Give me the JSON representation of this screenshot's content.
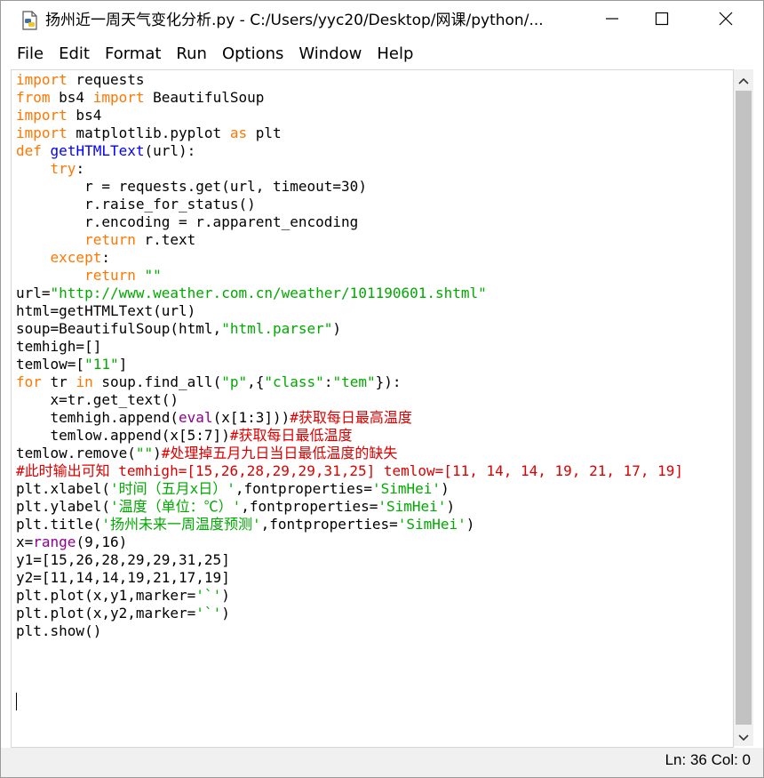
{
  "window": {
    "title": "扬州近一周天气变化分析.py - C:/Users/yyc20/Desktop/网课/python/...",
    "icons": {
      "app": "python-file-icon",
      "minimize": "minimize-icon",
      "maximize": "maximize-icon",
      "close": "close-icon"
    }
  },
  "menubar": {
    "items": [
      "File",
      "Edit",
      "Format",
      "Run",
      "Options",
      "Window",
      "Help"
    ]
  },
  "editor": {
    "lines": [
      [
        [
          "kw",
          "import"
        ],
        [
          "n",
          " requests"
        ]
      ],
      [
        [
          "kw",
          "from"
        ],
        [
          "n",
          " bs4 "
        ],
        [
          "kw",
          "import"
        ],
        [
          "n",
          " BeautifulSoup"
        ]
      ],
      [
        [
          "kw",
          "import"
        ],
        [
          "n",
          " bs4"
        ]
      ],
      [
        [
          "kw",
          "import"
        ],
        [
          "n",
          " matplotlib.pyplot "
        ],
        [
          "kw",
          "as"
        ],
        [
          "n",
          " plt"
        ]
      ],
      [
        [
          "kw",
          "def"
        ],
        [
          "n",
          " "
        ],
        [
          "df",
          "getHTMLText"
        ],
        [
          "n",
          "(url):"
        ]
      ],
      [
        [
          "n",
          "    "
        ],
        [
          "kw",
          "try"
        ],
        [
          "n",
          ":"
        ]
      ],
      [
        [
          "n",
          "        r = requests.get(url, timeout=30)"
        ]
      ],
      [
        [
          "n",
          "        r.raise_for_status()"
        ]
      ],
      [
        [
          "n",
          "        r.encoding = r.apparent_encoding"
        ]
      ],
      [
        [
          "n",
          "        "
        ],
        [
          "kw",
          "return"
        ],
        [
          "n",
          " r.text"
        ]
      ],
      [
        [
          "n",
          "    "
        ],
        [
          "kw",
          "except"
        ],
        [
          "n",
          ":"
        ]
      ],
      [
        [
          "n",
          "        "
        ],
        [
          "kw",
          "return"
        ],
        [
          "st",
          " \"\""
        ]
      ],
      [
        [
          "n",
          "url="
        ],
        [
          "st",
          "\"http://www.weather.com.cn/weather/101190601.shtml\""
        ]
      ],
      [
        [
          "n",
          "html=getHTMLText(url)"
        ]
      ],
      [
        [
          "n",
          "soup=BeautifulSoup(html,"
        ],
        [
          "st",
          "\"html.parser\""
        ],
        [
          "n",
          ")"
        ]
      ],
      [
        [
          "n",
          "temhigh=[]"
        ]
      ],
      [
        [
          "n",
          "temlow=["
        ],
        [
          "st",
          "\"11\""
        ],
        [
          "n",
          "]"
        ]
      ],
      [
        [
          "kw",
          "for"
        ],
        [
          "n",
          " tr "
        ],
        [
          "kw",
          "in"
        ],
        [
          "n",
          " soup.find_all("
        ],
        [
          "st",
          "\"p\""
        ],
        [
          "n",
          ",{"
        ],
        [
          "st",
          "\"class\""
        ],
        [
          "n",
          ":"
        ],
        [
          "st",
          "\"tem\""
        ],
        [
          "n",
          "}):"
        ]
      ],
      [
        [
          "n",
          "    x=tr.get_text()"
        ]
      ],
      [
        [
          "n",
          "    temhigh.append("
        ],
        [
          "bi",
          "eval"
        ],
        [
          "n",
          "(x[1:3]))"
        ],
        [
          "cm",
          "#获取每日最高温度"
        ]
      ],
      [
        [
          "n",
          "    temlow.append(x[5:7])"
        ],
        [
          "cm",
          "#获取每日最低温度"
        ]
      ],
      [
        [
          "n",
          "temlow.remove("
        ],
        [
          "st",
          "\"\""
        ],
        [
          "n",
          ")"
        ],
        [
          "cm",
          "#处理掉五月九日当日最低温度的缺失"
        ]
      ],
      [
        [
          "cm",
          "#此时输出可知 temhigh=[15,26,28,29,29,31,25] temlow=[11, 14, 14, 19, 21, 17, 19]"
        ]
      ],
      [
        [
          "n",
          "plt.xlabel("
        ],
        [
          "st",
          "'时间（五月x日）'"
        ],
        [
          "n",
          ",fontproperties="
        ],
        [
          "st",
          "'SimHei'"
        ],
        [
          "n",
          ")"
        ]
      ],
      [
        [
          "n",
          "plt.ylabel("
        ],
        [
          "st",
          "'温度（单位：℃）'"
        ],
        [
          "n",
          ",fontproperties="
        ],
        [
          "st",
          "'SimHei'"
        ],
        [
          "n",
          ")"
        ]
      ],
      [
        [
          "n",
          "plt.title("
        ],
        [
          "st",
          "'扬州未来一周温度预测'"
        ],
        [
          "n",
          ",fontproperties="
        ],
        [
          "st",
          "'SimHei'"
        ],
        [
          "n",
          ")"
        ]
      ],
      [
        [
          "n",
          "x="
        ],
        [
          "bi",
          "range"
        ],
        [
          "n",
          "(9,16)"
        ]
      ],
      [
        [
          "n",
          "y1=[15,26,28,29,29,31,25]"
        ]
      ],
      [
        [
          "n",
          "y2=[11,14,14,19,21,17,19]"
        ]
      ],
      [
        [
          "n",
          "plt.plot(x,y1,marker="
        ],
        [
          "st",
          "'`'"
        ],
        [
          "n",
          ")"
        ]
      ],
      [
        [
          "n",
          "plt.plot(x,y2,marker="
        ],
        [
          "st",
          "'`'"
        ],
        [
          "n",
          ")"
        ]
      ],
      [
        [
          "n",
          "plt.show()"
        ]
      ]
    ],
    "colors": {
      "keyword": "#ff7700",
      "builtin": "#900090",
      "string": "#00aa00",
      "comment": "#dd0000",
      "definition": "#0000ff"
    }
  },
  "scrollbar": {
    "up_icon": "triangle-up-icon",
    "down_icon": "triangle-down-icon"
  },
  "statusbar": {
    "position": "Ln: 36  Col: 0"
  }
}
